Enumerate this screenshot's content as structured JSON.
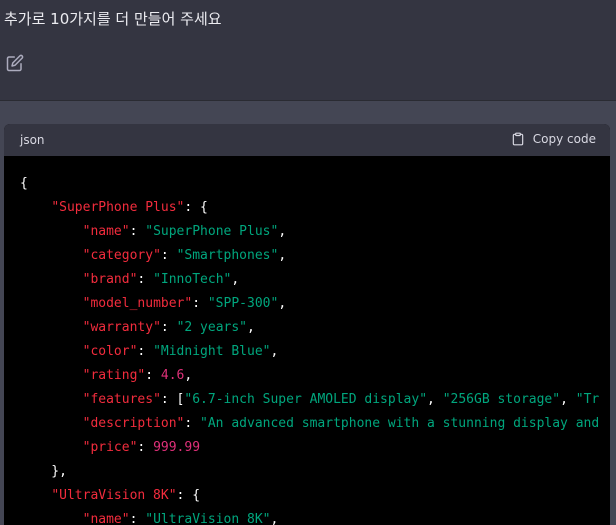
{
  "user_message": {
    "text": "추가로 10가지를 더 만들어 주세요"
  },
  "code_block": {
    "language": "json",
    "copy_label": "Copy code",
    "lines": [
      [
        [
          "p",
          "{"
        ]
      ],
      [
        [
          "p",
          "    "
        ],
        [
          "k",
          "\"SuperPhone Plus\""
        ],
        [
          "p",
          ": {"
        ]
      ],
      [
        [
          "p",
          "        "
        ],
        [
          "k",
          "\"name\""
        ],
        [
          "p",
          ": "
        ],
        [
          "s",
          "\"SuperPhone Plus\""
        ],
        [
          "p",
          ","
        ]
      ],
      [
        [
          "p",
          "        "
        ],
        [
          "k",
          "\"category\""
        ],
        [
          "p",
          ": "
        ],
        [
          "s",
          "\"Smartphones\""
        ],
        [
          "p",
          ","
        ]
      ],
      [
        [
          "p",
          "        "
        ],
        [
          "k",
          "\"brand\""
        ],
        [
          "p",
          ": "
        ],
        [
          "s",
          "\"InnoTech\""
        ],
        [
          "p",
          ","
        ]
      ],
      [
        [
          "p",
          "        "
        ],
        [
          "k",
          "\"model_number\""
        ],
        [
          "p",
          ": "
        ],
        [
          "s",
          "\"SPP-300\""
        ],
        [
          "p",
          ","
        ]
      ],
      [
        [
          "p",
          "        "
        ],
        [
          "k",
          "\"warranty\""
        ],
        [
          "p",
          ": "
        ],
        [
          "s",
          "\"2 years\""
        ],
        [
          "p",
          ","
        ]
      ],
      [
        [
          "p",
          "        "
        ],
        [
          "k",
          "\"color\""
        ],
        [
          "p",
          ": "
        ],
        [
          "s",
          "\"Midnight Blue\""
        ],
        [
          "p",
          ","
        ]
      ],
      [
        [
          "p",
          "        "
        ],
        [
          "k",
          "\"rating\""
        ],
        [
          "p",
          ": "
        ],
        [
          "n",
          "4.6"
        ],
        [
          "p",
          ","
        ]
      ],
      [
        [
          "p",
          "        "
        ],
        [
          "k",
          "\"features\""
        ],
        [
          "p",
          ": ["
        ],
        [
          "s",
          "\"6.7-inch Super AMOLED display\""
        ],
        [
          "p",
          ", "
        ],
        [
          "s",
          "\"256GB storage\""
        ],
        [
          "p",
          ", "
        ],
        [
          "s",
          "\"Tr"
        ]
      ],
      [
        [
          "p",
          "        "
        ],
        [
          "k",
          "\"description\""
        ],
        [
          "p",
          ": "
        ],
        [
          "s",
          "\"An advanced smartphone with a stunning display and"
        ]
      ],
      [
        [
          "p",
          "        "
        ],
        [
          "k",
          "\"price\""
        ],
        [
          "p",
          ": "
        ],
        [
          "n",
          "999.99"
        ]
      ],
      [
        [
          "p",
          "    },"
        ]
      ],
      [
        [
          "p",
          "    "
        ],
        [
          "k",
          "\"UltraVision 8K\""
        ],
        [
          "p",
          ": {"
        ]
      ],
      [
        [
          "p",
          "        "
        ],
        [
          "k",
          "\"name\""
        ],
        [
          "p",
          ": "
        ],
        [
          "s",
          "\"UltraVision 8K\""
        ],
        [
          "p",
          ","
        ]
      ]
    ]
  }
}
